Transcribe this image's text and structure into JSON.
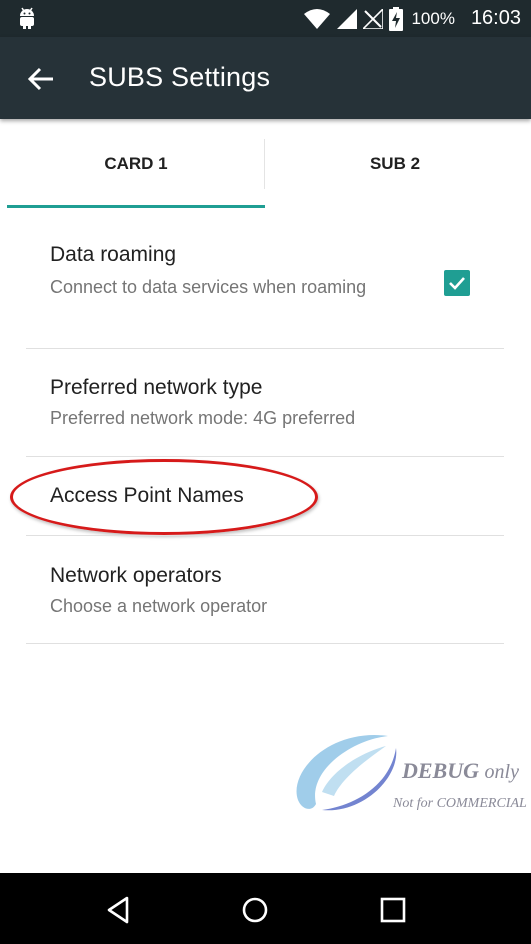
{
  "status_bar": {
    "battery_percent": "100%",
    "time": "16:03",
    "icons": [
      "android-debug-icon",
      "wifi-icon",
      "signal-icon",
      "no-signal-icon",
      "battery-charging-icon"
    ]
  },
  "app_bar": {
    "back_icon": "arrow-back-icon",
    "title": "SUBS Settings"
  },
  "tabs": [
    {
      "label": "CARD 1",
      "selected": true
    },
    {
      "label": "SUB 2",
      "selected": false
    }
  ],
  "settings": {
    "data_roaming": {
      "title": "Data roaming",
      "summary": "Connect to data services when roaming",
      "checked": true
    },
    "preferred_network": {
      "title": "Preferred network type",
      "summary": "Preferred network mode: 4G preferred"
    },
    "access_point_names": {
      "title": "Access Point Names"
    },
    "network_operators": {
      "title": "Network operators",
      "summary": "Choose a network operator"
    }
  },
  "watermark": {
    "debug": "DEBUG",
    "only": "only",
    "note": "Not for COMMERCIAL"
  },
  "nav_bar": {
    "icons": [
      "back-triangle-icon",
      "home-circle-icon",
      "recents-square-icon"
    ]
  },
  "colors": {
    "status_bar": "#1f2a2e",
    "app_bar": "#263238",
    "accent": "#1f9e93",
    "highlight": "#d61a1a"
  }
}
